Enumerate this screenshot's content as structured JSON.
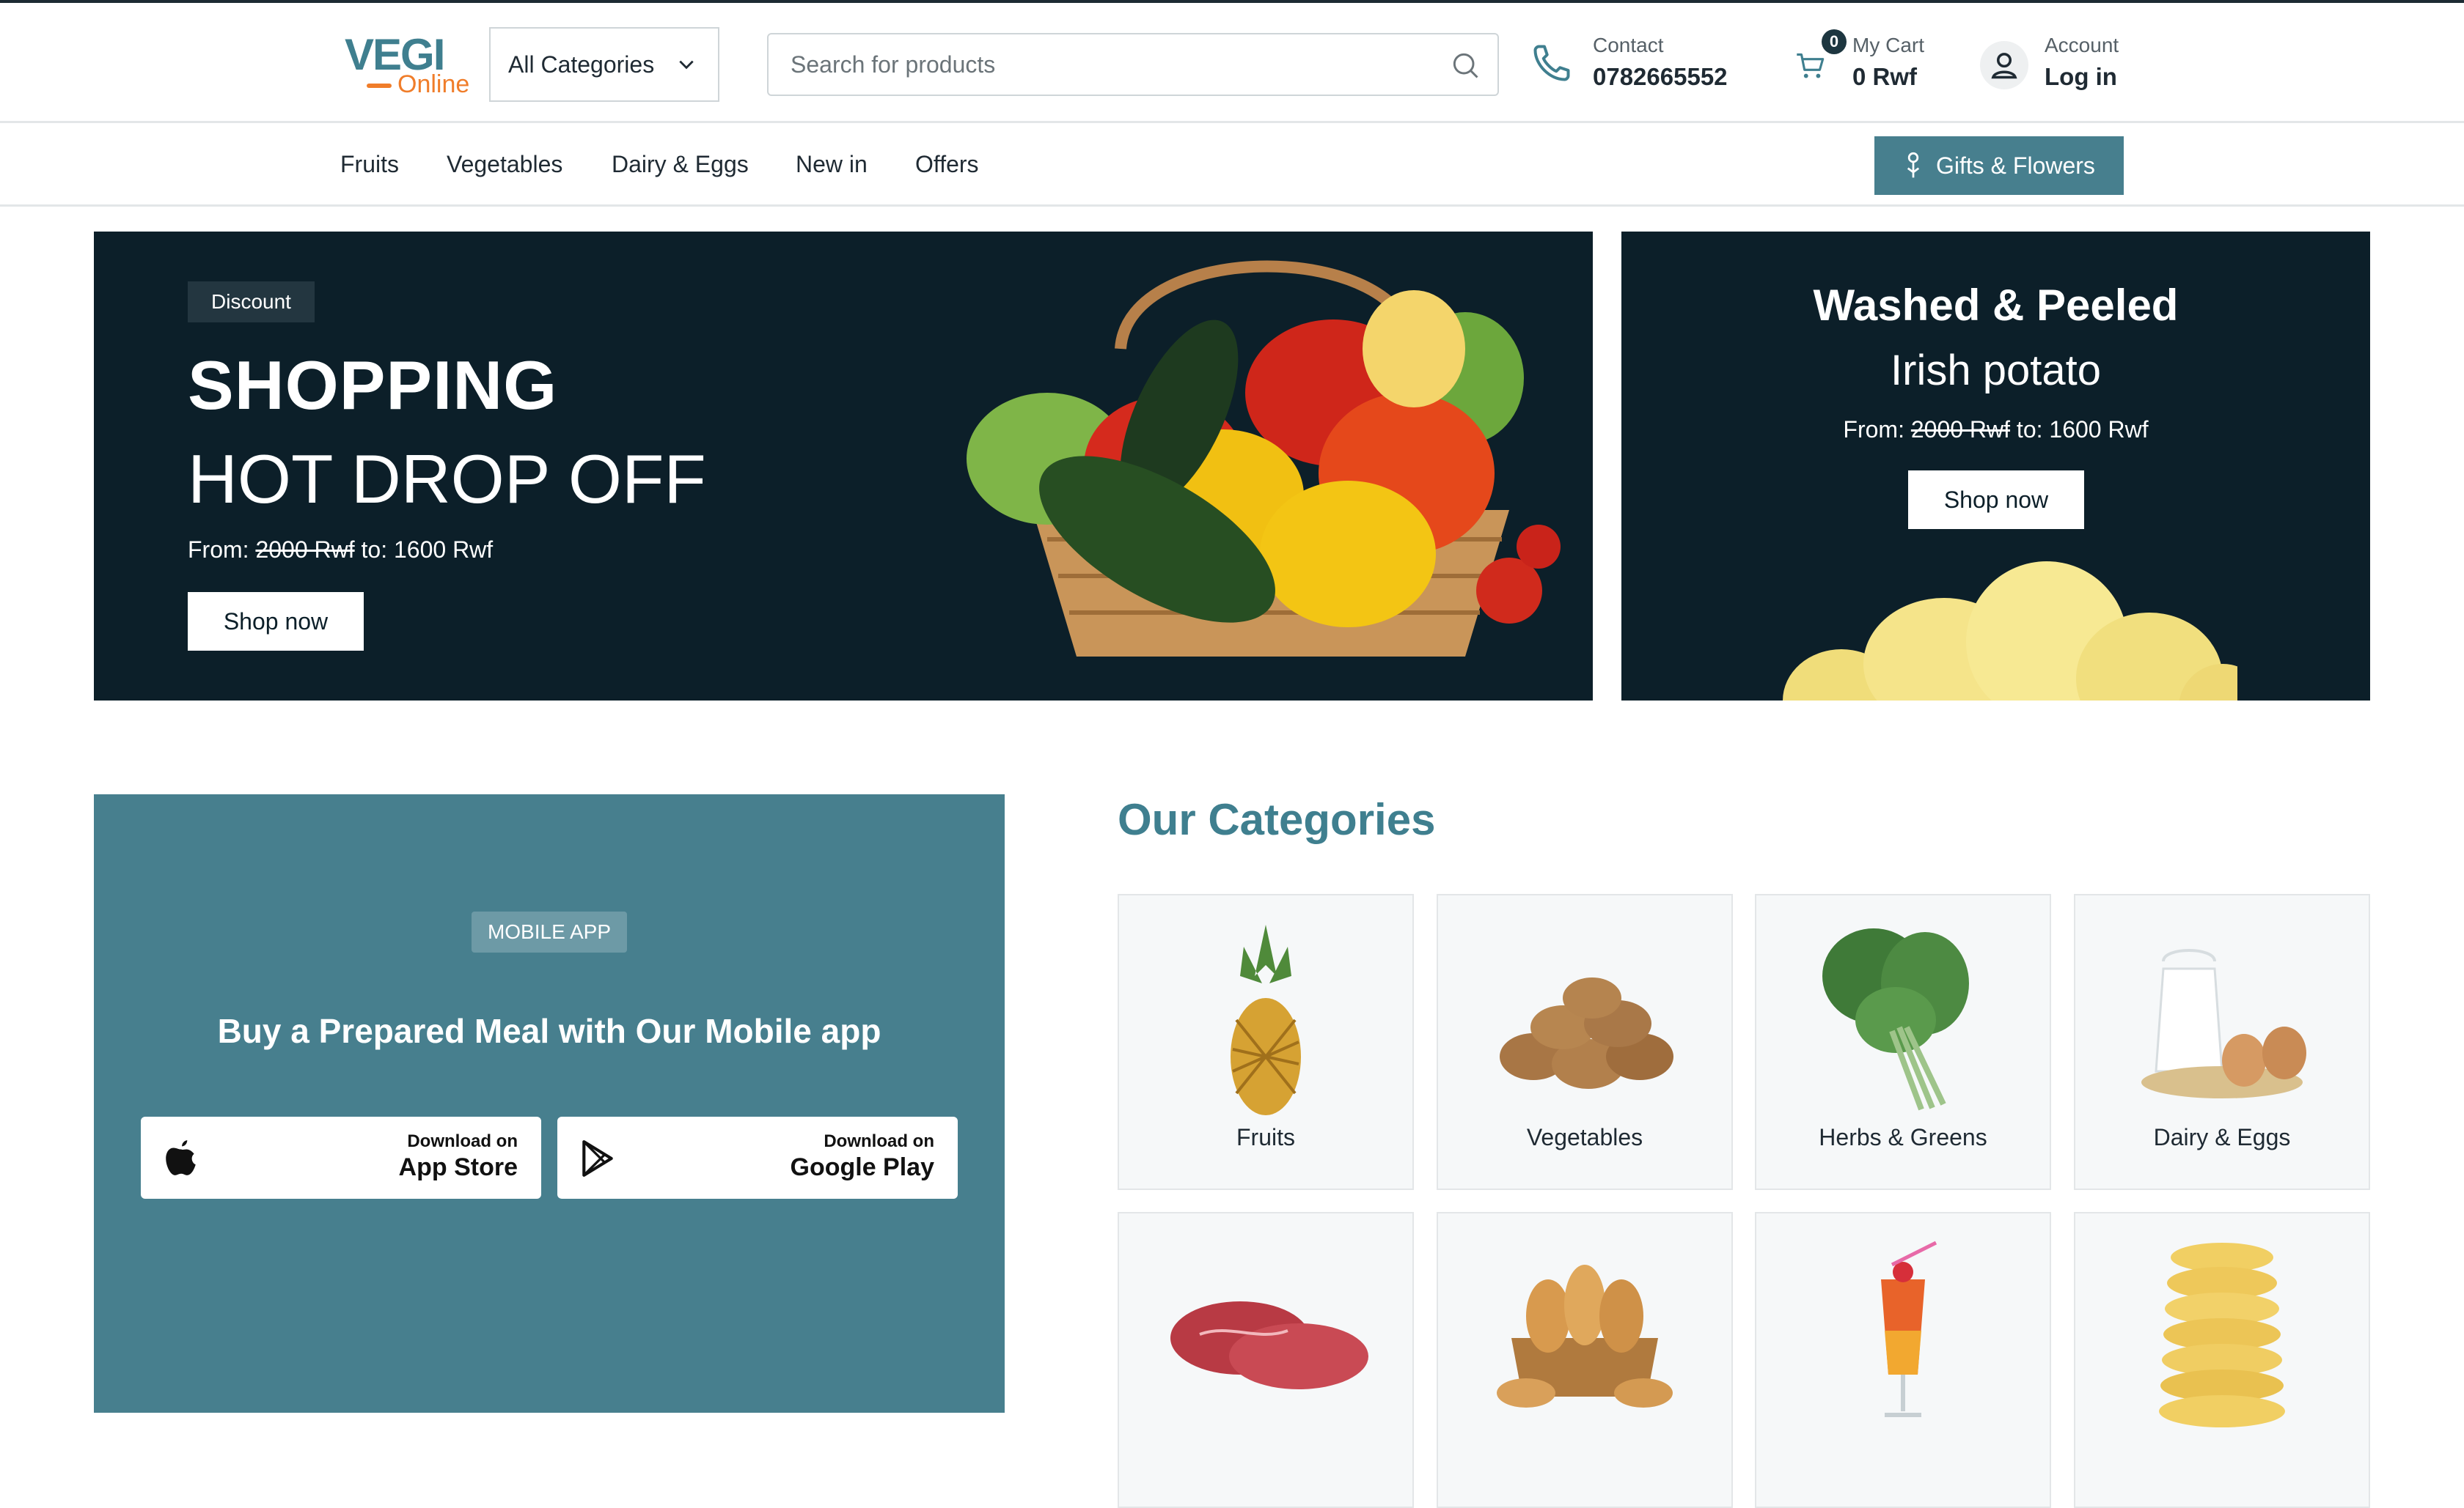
{
  "header": {
    "logo_main": "VEGI",
    "logo_sub": "Online",
    "category_select": "All Categories",
    "search_placeholder": "Search for products",
    "contact_label": "Contact",
    "contact_value": "0782665552",
    "cart_count": "0",
    "cart_label": "My Cart",
    "cart_value": "0 Rwf",
    "account_label": "Account",
    "account_value": "Log in"
  },
  "nav": {
    "items": [
      "Fruits",
      "Vegetables",
      "Dairy & Eggs",
      "New in",
      "Offers"
    ],
    "gifts_label": "Gifts & Flowers"
  },
  "hero": {
    "badge": "Discount",
    "title1": "SHOPPING",
    "title2": "HOT DROP OFF",
    "from": "From:",
    "old_price": "2000 Rwf",
    "to": "to: 1600 Rwf",
    "button": "Shop now"
  },
  "side_banner": {
    "title": "Washed & Peeled",
    "subtitle": "Irish potato",
    "from": "From:",
    "old_price": "2000 Rwf",
    "to": "to: 1600 Rwf",
    "button": "Shop now"
  },
  "app_section": {
    "badge": "MOBILE APP",
    "title": "Buy a Prepared Meal with Our Mobile app",
    "appstore_small": "Download on",
    "appstore_large": "App Store",
    "gplay_small": "Download on",
    "gplay_large": "Google Play"
  },
  "categories": {
    "title": "Our Categories",
    "items": [
      "Fruits",
      "Vegetables",
      "Herbs & Greens",
      "Dairy & Eggs"
    ]
  },
  "colors": {
    "accent": "#477f8e",
    "dark": "#0c1f29",
    "orange": "#f07d2a"
  }
}
